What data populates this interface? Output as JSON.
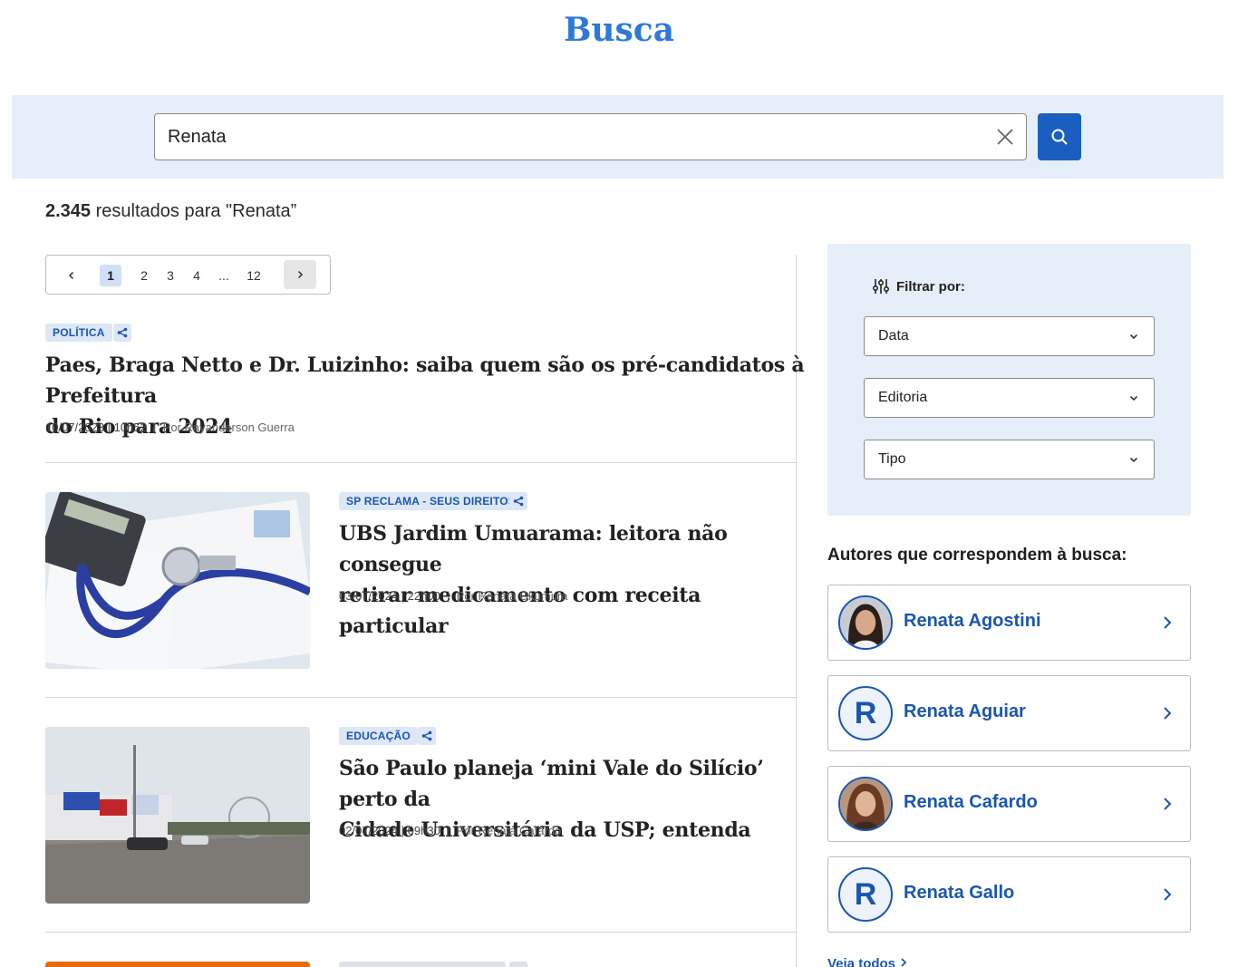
{
  "page": {
    "title": "Busca"
  },
  "search": {
    "value": "Renata",
    "placeholder": ""
  },
  "results": {
    "count": "2.345",
    "label": " resultados para \"Renata”"
  },
  "pagination": {
    "pages": [
      "1",
      "2",
      "3",
      "4",
      "...",
      "12"
    ],
    "current": "1"
  },
  "articles": [
    {
      "category": "POLÍTICA",
      "title_line1": "Paes, Braga Netto e Dr. Luizinho: saiba quem são os pré-candidatos à Prefeitura",
      "title_line2": "do Rio para 2024",
      "date": "10/07/2023 | 10h52",
      "author": "Por Rayanderson Guerra"
    },
    {
      "category": "SP RECLAMA - SEUS DIREITOS",
      "title_line1": "UBS Jardim Umuarama: leitora não consegue",
      "title_line2": "retirar medicamento com receita particular",
      "date": "03/07/2024 |  22h00",
      "author": "Por Renata Okumura"
    },
    {
      "category": "EDUCAÇÃO",
      "title_line1": "São Paulo planeja ‘mini Vale do Silício’ perto da",
      "title_line2": "Cidade Universitária da USP; entenda",
      "date": "02/07/2024 | 09h30",
      "author": "Por Renata Cafardo"
    }
  ],
  "filters": {
    "title": "Filtrar por:",
    "selects": [
      "Data",
      "Editoria",
      "Tipo"
    ]
  },
  "authors": {
    "title": "Autores que correspondem à busca:",
    "items": [
      {
        "name": "Renata Agostini",
        "initial": "",
        "photo": true
      },
      {
        "name": "Renata Aguiar",
        "initial": "R",
        "photo": false
      },
      {
        "name": "Renata Cafardo",
        "initial": "",
        "photo": true
      },
      {
        "name": "Renata Gallo",
        "initial": "R",
        "photo": false
      }
    ],
    "see_all": "Veja todos"
  },
  "colors": {
    "accent": "#1a56b0",
    "title": "#2d78d8",
    "band": "#e6eef9"
  }
}
